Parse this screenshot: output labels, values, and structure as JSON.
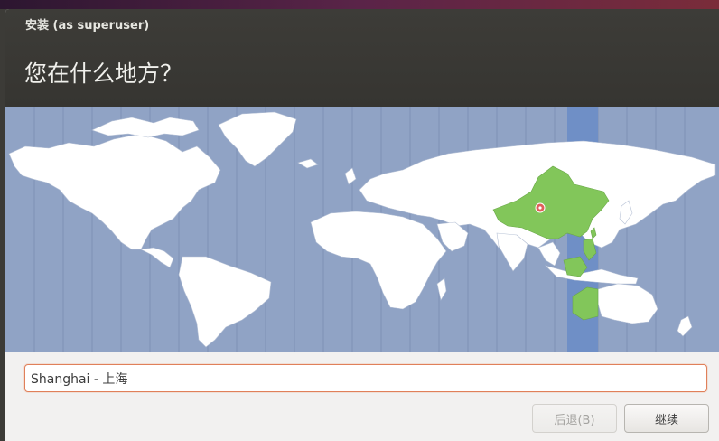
{
  "window": {
    "title": "安装 (as superuser)"
  },
  "page": {
    "title": "您在什么地方？"
  },
  "map": {
    "selected_region_color": "#82c65a",
    "highlight_band_color": "#6f8fc6",
    "land_color": "#ffffff",
    "ocean_color": "#90a3c5"
  },
  "timezone_input": {
    "value": "Shanghai - 上海"
  },
  "buttons": {
    "back_label": "后退(B)",
    "next_label": "继续"
  },
  "colors": {
    "titlebar": "#3c3b37",
    "input_focus_border": "#e0805a"
  }
}
